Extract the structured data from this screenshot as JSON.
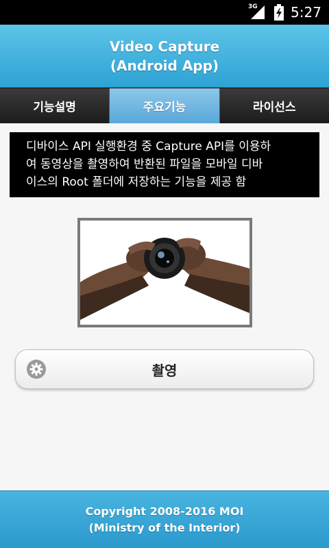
{
  "status_bar": {
    "network": "3G",
    "time": "5:27"
  },
  "header": {
    "title_line1": "Video Capture",
    "title_line2": "(Android App)"
  },
  "tabs": [
    {
      "label": "기능설명",
      "active": false
    },
    {
      "label": "주요기능",
      "active": true
    },
    {
      "label": "라이선스",
      "active": false
    }
  ],
  "description": {
    "line1": "디바이스 API 실행환경 중 Capture API를 이용하",
    "line2": "여 동영상을 촬영하여 반환된 파일을 모바일 디바",
    "line3": "이스의 Root 폴더에 저장하는 기능을 제공 함"
  },
  "capture_button": {
    "label": "촬영",
    "icon": "gear-icon"
  },
  "footer": {
    "line1": "Copyright 2008-2016 MOI",
    "line2": "(Ministry of the Interior)"
  },
  "colors": {
    "header_blue": "#3fb2df",
    "active_tab": "#7ab9e3",
    "dark_tab": "#2a2a2a",
    "desc_bg": "#000000"
  }
}
